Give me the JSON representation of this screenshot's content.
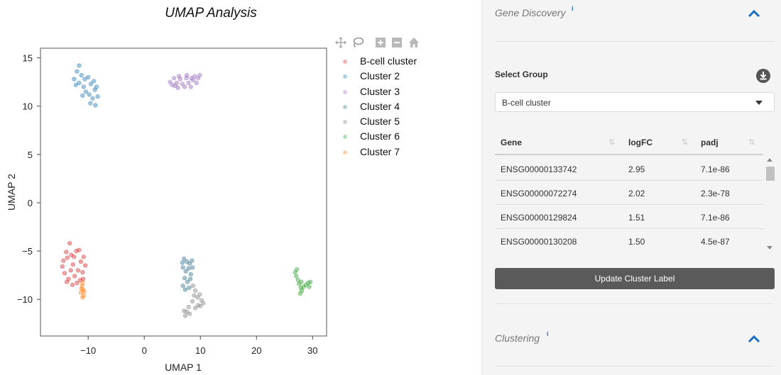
{
  "chart_data": {
    "type": "scatter",
    "title": "UMAP Analysis",
    "xlabel": "UMAP 1",
    "ylabel": "UMAP 2",
    "xlim": [
      -18.5,
      32.5
    ],
    "ylim": [
      -13.8,
      16.0
    ],
    "xticks": [
      -10,
      0,
      10,
      20,
      30
    ],
    "xtick_labels": [
      "−10",
      "0",
      "10",
      "20",
      "30"
    ],
    "yticks": [
      15,
      10,
      5,
      0,
      -5,
      -10
    ],
    "ytick_labels": [
      "15",
      "10",
      "5",
      "0",
      "−5",
      "−10"
    ],
    "grid": false,
    "legend_position": "right",
    "series": [
      {
        "name": "B-cell cluster",
        "color": "#d62728",
        "points": [
          [
            -14.6,
            -6.6
          ],
          [
            -14.2,
            -7.3
          ],
          [
            -13.8,
            -8.2
          ],
          [
            -13.9,
            -5.1
          ],
          [
            -13.3,
            -4.2
          ],
          [
            -13.0,
            -5.4
          ],
          [
            -12.7,
            -6.4
          ],
          [
            -12.4,
            -7.6
          ],
          [
            -12.8,
            -8.5
          ],
          [
            -12.1,
            -5.0
          ],
          [
            -11.6,
            -4.9
          ],
          [
            -11.3,
            -6.1
          ],
          [
            -11.0,
            -7.2
          ],
          [
            -11.4,
            -8.0
          ],
          [
            -10.8,
            -5.6
          ],
          [
            -10.5,
            -6.5
          ],
          [
            -13.5,
            -7.9
          ],
          [
            -12.0,
            -8.3
          ],
          [
            -14.4,
            -6.0
          ],
          [
            -11.8,
            -7.0
          ],
          [
            -13.1,
            -7.0
          ],
          [
            -12.5,
            -5.6
          ],
          [
            -10.9,
            -7.9
          ],
          [
            -13.7,
            -5.7
          ]
        ]
      },
      {
        "name": "Cluster 2",
        "color": "#1f77b4",
        "points": [
          [
            -12.5,
            12.8
          ],
          [
            -12.0,
            13.6
          ],
          [
            -11.6,
            14.2
          ],
          [
            -11.2,
            13.2
          ],
          [
            -11.6,
            12.4
          ],
          [
            -10.8,
            12.0
          ],
          [
            -10.4,
            11.5
          ],
          [
            -10.6,
            12.8
          ],
          [
            -10.0,
            13.0
          ],
          [
            -9.5,
            12.3
          ],
          [
            -9.8,
            11.2
          ],
          [
            -9.2,
            10.8
          ],
          [
            -8.7,
            10.1
          ],
          [
            -8.3,
            11.0
          ],
          [
            -8.5,
            12.0
          ],
          [
            -9.0,
            12.6
          ],
          [
            -11.0,
            11.1
          ],
          [
            -9.6,
            10.3
          ],
          [
            -8.8,
            11.7
          ],
          [
            -12.2,
            12.2
          ]
        ]
      },
      {
        "name": "Cluster 3",
        "color": "#9467bd",
        "points": [
          [
            4.6,
            12.5
          ],
          [
            5.0,
            12.2
          ],
          [
            5.3,
            12.9
          ],
          [
            5.8,
            12.4
          ],
          [
            6.0,
            11.9
          ],
          [
            6.4,
            12.8
          ],
          [
            6.8,
            12.3
          ],
          [
            7.2,
            12.0
          ],
          [
            7.5,
            12.9
          ],
          [
            7.9,
            12.4
          ],
          [
            8.3,
            12.0
          ],
          [
            8.7,
            12.7
          ],
          [
            9.0,
            13.1
          ],
          [
            9.3,
            12.4
          ],
          [
            9.6,
            12.9
          ],
          [
            9.9,
            13.2
          ],
          [
            6.2,
            13.1
          ],
          [
            7.6,
            13.2
          ],
          [
            8.4,
            12.9
          ],
          [
            5.5,
            12.1
          ]
        ]
      },
      {
        "name": "Cluster 4",
        "color": "#2a6f89",
        "points": [
          [
            7.1,
            -5.8
          ],
          [
            7.6,
            -6.1
          ],
          [
            8.1,
            -6.3
          ],
          [
            8.5,
            -6.0
          ],
          [
            6.9,
            -6.7
          ],
          [
            7.4,
            -7.1
          ],
          [
            7.9,
            -6.8
          ],
          [
            8.3,
            -7.4
          ],
          [
            7.2,
            -7.8
          ],
          [
            7.7,
            -8.2
          ],
          [
            8.2,
            -7.9
          ],
          [
            6.9,
            -8.6
          ],
          [
            7.3,
            -9.0
          ],
          [
            8.0,
            -8.8
          ],
          [
            6.8,
            -6.2
          ],
          [
            8.6,
            -6.7
          ]
        ]
      },
      {
        "name": "Cluster 5",
        "color": "#7f7f7f",
        "points": [
          [
            8.7,
            -8.6
          ],
          [
            9.1,
            -9.1
          ],
          [
            8.9,
            -9.6
          ],
          [
            9.5,
            -9.8
          ],
          [
            9.9,
            -9.5
          ],
          [
            10.2,
            -10.1
          ],
          [
            10.5,
            -10.4
          ],
          [
            9.6,
            -10.6
          ],
          [
            9.1,
            -10.9
          ],
          [
            8.6,
            -10.2
          ],
          [
            7.9,
            -10.8
          ],
          [
            7.6,
            -11.3
          ],
          [
            7.3,
            -11.7
          ],
          [
            7.1,
            -11.2
          ],
          [
            8.1,
            -11.5
          ],
          [
            10.0,
            -10.7
          ]
        ]
      },
      {
        "name": "Cluster 6",
        "color": "#2ca02c",
        "points": [
          [
            26.9,
            -7.2
          ],
          [
            27.2,
            -6.9
          ],
          [
            27.1,
            -7.6
          ],
          [
            27.4,
            -8.0
          ],
          [
            27.6,
            -8.4
          ],
          [
            27.9,
            -8.8
          ],
          [
            28.1,
            -9.1
          ],
          [
            27.8,
            -9.4
          ],
          [
            28.4,
            -8.7
          ],
          [
            28.8,
            -8.5
          ],
          [
            29.2,
            -8.3
          ],
          [
            29.6,
            -8.2
          ],
          [
            29.4,
            -8.7
          ],
          [
            28.0,
            -8.2
          ]
        ]
      },
      {
        "name": "Cluster 7",
        "color": "#ff7f0e",
        "points": [
          [
            -11.1,
            -8.6
          ],
          [
            -10.9,
            -9.0
          ],
          [
            -11.3,
            -9.3
          ],
          [
            -10.8,
            -9.6
          ],
          [
            -11.0,
            -8.3
          ],
          [
            -11.2,
            -8.9
          ],
          [
            -10.7,
            -9.2
          ],
          [
            -11.0,
            -9.8
          ]
        ]
      }
    ]
  },
  "modebar": {
    "icons": [
      "pan-icon",
      "lasso-icon",
      "zoom-in-icon",
      "zoom-out-icon",
      "reset-home-icon"
    ]
  },
  "panel": {
    "gene_discovery": {
      "title": "Gene Discovery",
      "info": "i"
    },
    "select_group": {
      "label": "Select Group",
      "selected": "B-cell cluster"
    },
    "table": {
      "columns": [
        "Gene",
        "logFC",
        "padj"
      ],
      "rows": [
        [
          "ENSG00000133742",
          "2.95",
          "7.1e-86"
        ],
        [
          "ENSG00000072274",
          "2.02",
          "2.3e-78"
        ],
        [
          "ENSG00000129824",
          "1.51",
          "7.1e-86"
        ],
        [
          "ENSG00000130208",
          "1.50",
          "4.5e-87"
        ]
      ]
    },
    "update_button": "Update Cluster Label",
    "clustering": {
      "title": "Clustering",
      "info": "i"
    }
  },
  "colors": {
    "accent": "#1a6fc4",
    "button": "#5a5a5a",
    "panel_bg": "#f4f4f4"
  }
}
